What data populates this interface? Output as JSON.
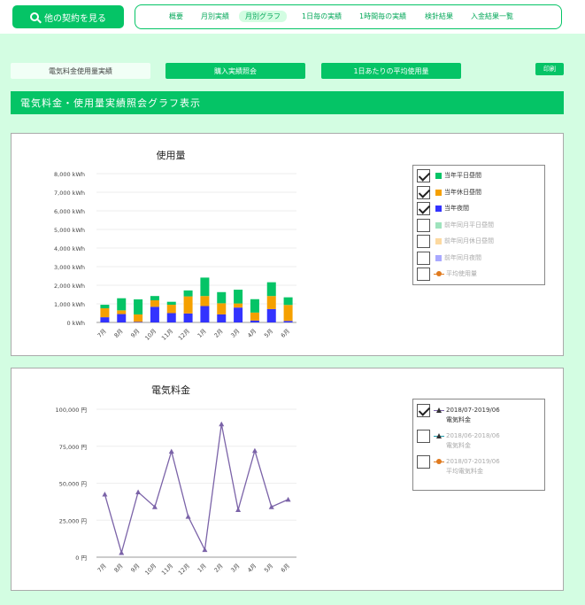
{
  "header": {
    "other_contract_label": "他の契約を見る",
    "nav": [
      {
        "label": "概要",
        "active": false
      },
      {
        "label": "月別実績",
        "active": false
      },
      {
        "label": "月別グラフ",
        "active": true
      },
      {
        "label": "1日毎の実績",
        "active": false
      },
      {
        "label": "1時間毎の実績",
        "active": false
      },
      {
        "label": "検針結果",
        "active": false
      },
      {
        "label": "入金結果一覧",
        "active": false
      }
    ]
  },
  "tabs": [
    {
      "label": "電気料金使用量実績",
      "selected": true
    },
    {
      "label": "購入実績照会",
      "selected": false
    },
    {
      "label": "1日あたりの平均使用量",
      "selected": false
    }
  ],
  "print_label": "印刷",
  "section_title": "電気料金・使用量実績照会グラフ表示",
  "months": [
    "7月",
    "8月",
    "9月",
    "10月",
    "11月",
    "12月",
    "1月",
    "2月",
    "3月",
    "4月",
    "5月",
    "6月"
  ],
  "usage_chart": {
    "title": "使用量",
    "y_ticks": [
      "8,000 kWh",
      "7,000 kWh",
      "6,000 kWh",
      "5,000 kWh",
      "4,000 kWh",
      "3,000 kWh",
      "2,000 kWh",
      "1,000 kWh",
      "0 kWh"
    ],
    "legend": [
      {
        "label": "当年平日昼間",
        "checked": true,
        "color": "#05c466",
        "kind": "sq"
      },
      {
        "label": "当年休日昼間",
        "checked": true,
        "color": "#f5a000",
        "kind": "sq"
      },
      {
        "label": "当年夜間",
        "checked": true,
        "color": "#3333ff",
        "kind": "sq"
      },
      {
        "label": "前年同月平日昼間",
        "checked": false,
        "color": "#9ee3bd",
        "kind": "sq"
      },
      {
        "label": "前年同月休日昼間",
        "checked": false,
        "color": "#fcd9a0",
        "kind": "sq"
      },
      {
        "label": "前年同月夜間",
        "checked": false,
        "color": "#a9a9ff",
        "kind": "sq"
      },
      {
        "label": "平均使用量",
        "checked": false,
        "color": "#e07a1e",
        "kind": "dot"
      }
    ]
  },
  "fee_chart": {
    "title": "電気料金",
    "y_ticks": [
      "100,000 円",
      "75,000 円",
      "50,000 円",
      "25,000 円",
      "0 円"
    ],
    "legend": [
      {
        "label": "2018/07-2019/06",
        "sub": "電気料金",
        "checked": true,
        "color": "#7b63a8",
        "kind": "tri"
      },
      {
        "label": "2018/06-2018/06",
        "sub": "電気料金",
        "checked": false,
        "color": "#1f9aa8",
        "kind": "tri"
      },
      {
        "label": "2018/07-2019/06",
        "sub": "平均電気料金",
        "checked": false,
        "color": "#e07a1e",
        "kind": "dot"
      }
    ]
  },
  "chart_data": [
    {
      "type": "bar",
      "title": "使用量",
      "categories": [
        "7月",
        "8月",
        "9月",
        "10月",
        "11月",
        "12月",
        "1月",
        "2月",
        "3月",
        "4月",
        "5月",
        "6月"
      ],
      "ylim": [
        0,
        3000
      ],
      "stacked": true,
      "series": [
        {
          "name": "当年夜間",
          "values": [
            280,
            450,
            30,
            840,
            500,
            480,
            880,
            430,
            800,
            100,
            720,
            80
          ]
        },
        {
          "name": "当年休日昼間",
          "values": [
            480,
            200,
            400,
            350,
            450,
            920,
            540,
            600,
            220,
            430,
            700,
            860
          ]
        },
        {
          "name": "当年平日昼間",
          "values": [
            190,
            650,
            810,
            230,
            160,
            320,
            990,
            600,
            740,
            720,
            740,
            410
          ]
        }
      ]
    },
    {
      "type": "line",
      "title": "電気料金",
      "categories": [
        "7月",
        "8月",
        "9月",
        "10月",
        "11月",
        "12月",
        "1月",
        "2月",
        "3月",
        "4月",
        "5月",
        "6月"
      ],
      "ylim": [
        0,
        100000
      ],
      "series": [
        {
          "name": "2018/07-2019/06 電気料金",
          "values": [
            42500,
            3000,
            44000,
            34000,
            71500,
            27500,
            5000,
            90000,
            32000,
            72000,
            34000,
            39000
          ]
        }
      ]
    }
  ]
}
